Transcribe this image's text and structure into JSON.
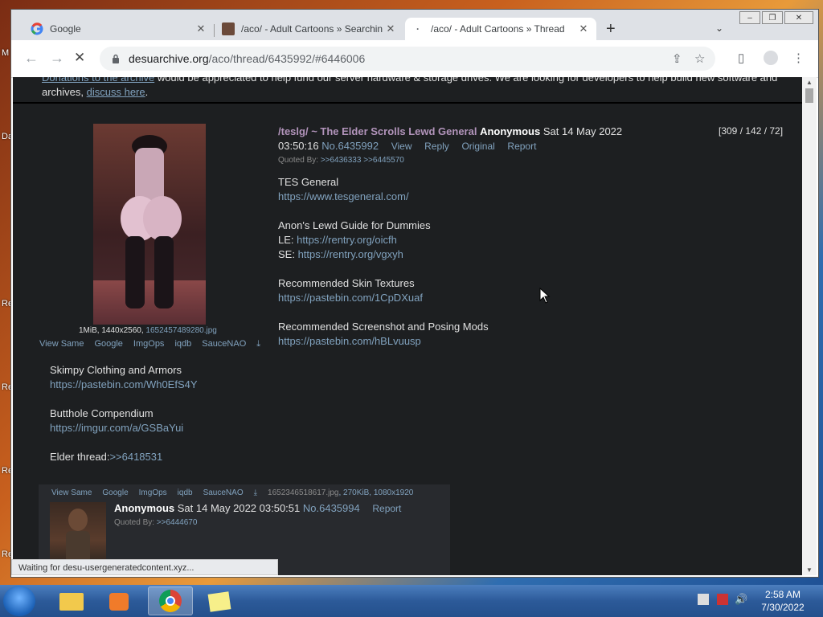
{
  "desktop": {
    "labels": [
      "M",
      "Da",
      "Re",
      "Re",
      "Re",
      "Re"
    ]
  },
  "browser": {
    "tabs": [
      {
        "title": "Google",
        "favicon": "google-g-icon",
        "active": false
      },
      {
        "title": "/aco/ - Adult Cartoons » Searchin",
        "favicon": "thumbnail-icon",
        "active": false
      },
      {
        "title": "/aco/ - Adult Cartoons » Thread",
        "favicon": "loading-icon",
        "active": true
      }
    ],
    "url_host": "desuarchive.org",
    "url_path": "/aco/thread/6435992/#6446006",
    "status_text": "Waiting for desu-usergeneratedcontent.xyz..."
  },
  "notice": {
    "link1": "Donations to the archive",
    "text1": " would be appreciated to help fund our server hardware & storage drives. We are looking for developers to help build new software and archives, ",
    "link2": "discuss here",
    "text2": "."
  },
  "op": {
    "file_size": "1MiB, 1440x2560, ",
    "file_name": "1652457489280.jpg",
    "image_tools": [
      "View Same",
      "Google",
      "ImgOps",
      "iqdb",
      "SauceNAO"
    ],
    "board": "/teslg/",
    "subject": " ~ The Elder Scrolls Lewd General",
    "name": "Anonymous",
    "date_part1": "Sat 14 May 2022",
    "date_part2": "03:50:16",
    "number": "No.6435992",
    "actions": [
      "View",
      "Reply",
      "Original",
      "Report"
    ],
    "counts": "[309 / 142 / 72]",
    "quoted_by_label": "Quoted By: ",
    "quoted_by": ">>6436333 >>6445570",
    "body": [
      {
        "text": "TES General",
        "link": "https://www.tesgeneral.com/"
      },
      {
        "text": "Anon's Lewd Guide for Dummies",
        "le_label": "LE: ",
        "le_link": "https://rentry.org/oicfh",
        "se_label": "SE: ",
        "se_link": "https://rentry.org/vgxyh"
      },
      {
        "text": "Recommended Skin Textures",
        "link": "https://pastebin.com/1CpDXuaf"
      },
      {
        "text": "Recommended Screenshot and Posing Mods",
        "link": "https://pastebin.com/hBLvuusp"
      },
      {
        "text": "Skimpy Clothing and Armors",
        "link": "https://pastebin.com/Wh0EfS4Y"
      },
      {
        "text": "Butthole Compendium",
        "link": "https://imgur.com/a/GSBaYui"
      }
    ],
    "elder_label": "Elder thread:",
    "elder_link": ">>6418531"
  },
  "reply": {
    "image_tools": [
      "View Same",
      "Google",
      "ImgOps",
      "iqdb",
      "SauceNAO"
    ],
    "file_name": "1652346518617.jpg",
    "file_info": ", 270KiB, 1080x1920",
    "name": "Anonymous",
    "date": "Sat 14 May 2022 03:50:51",
    "number": "No.6435994",
    "action": "Report",
    "quoted_by_label": "Quoted By: ",
    "quoted_by": ">>6444670"
  },
  "taskbar": {
    "time": "2:58 AM",
    "date": "7/30/2022"
  }
}
